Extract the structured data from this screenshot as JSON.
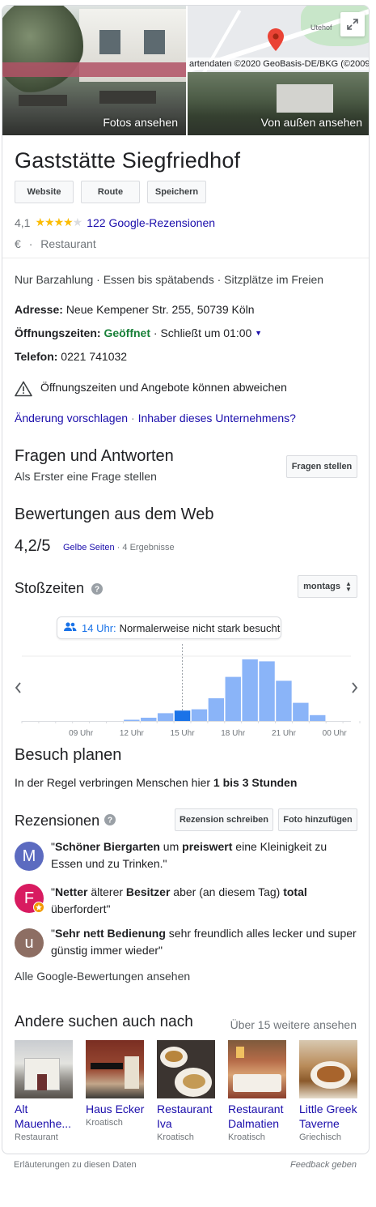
{
  "hero": {
    "photos_label": "Fotos ansehen",
    "outside_label": "Von außen ansehen",
    "map_credit": "artendaten ©2020 GeoBasis-DE/BKG (©2009)",
    "map_street": "Utehof"
  },
  "place": {
    "name": "Gaststätte Siegfriedhof",
    "buttons": [
      "Website",
      "Route",
      "Speichern"
    ],
    "rating": "4,1",
    "stars": 4,
    "reviews_link": "122 Google-Rezensionen",
    "price": "€",
    "separator": "·",
    "category": "Restaurant"
  },
  "details": {
    "attributes": "Nur Barzahlung · Essen bis spätabends · Sitzplätze im Freien",
    "address_label": "Adresse:",
    "address": "Neue Kempener Str. 255, 50739 Köln",
    "hours_label": "Öffnungszeiten:",
    "hours_status": "Geöffnet",
    "hours_close": "· Schließt um 01:00",
    "phone_label": "Telefon:",
    "phone": "0221 741032",
    "warning": "Öffnungszeiten und Angebote können abweichen",
    "suggest_edit": "Änderung vorschlagen",
    "dot": " · ",
    "owner": "Inhaber dieses Unternehmens?"
  },
  "qa": {
    "title": "Fragen und Antworten",
    "first_question": "Als Erster eine Frage stellen",
    "ask_button": "Fragen stellen"
  },
  "web_ratings": {
    "title": "Bewertungen aus dem Web",
    "score": "4,2/5",
    "source": "Gelbe Seiten",
    "results": "· 4 Ergebnisse"
  },
  "popular_times": {
    "title": "Stoßzeiten",
    "day": "montags",
    "tooltip_time": "14 Uhr:",
    "tooltip_text": "Normalerweise nicht stark besucht",
    "current_hour_index": 9
  },
  "chart_data": {
    "type": "bar",
    "categories": [
      "06",
      "07",
      "08",
      "09",
      "10",
      "11",
      "12",
      "13",
      "14",
      "15",
      "16",
      "17",
      "18",
      "19",
      "20",
      "21",
      "22",
      "23",
      "00",
      "01"
    ],
    "values": [
      0,
      0,
      0,
      0,
      0,
      0,
      1,
      5,
      12,
      16,
      18,
      35,
      68,
      95,
      92,
      62,
      28,
      9,
      0,
      0
    ],
    "tick_labels": [
      "09 Uhr",
      "12 Uhr",
      "15 Uhr",
      "18 Uhr",
      "21 Uhr",
      "00 Uhr"
    ],
    "tick_indices": [
      3,
      6,
      9,
      12,
      15,
      18
    ],
    "ylim": [
      0,
      100
    ],
    "colors": {
      "bar": "#8ab4f8",
      "current": "#1a73e8",
      "tooltip_icon": "#1a73e8"
    }
  },
  "visit": {
    "title": "Besuch planen",
    "text_prefix": "In der Regel verbringen Menschen hier ",
    "duration": "1 bis 3 Stunden"
  },
  "reviews": {
    "title": "Rezensionen",
    "write_button": "Rezension schreiben",
    "photo_button": "Foto hinzufügen",
    "items": [
      {
        "initial": "M",
        "color": "#5c6bc0",
        "parts": [
          "\"",
          "Schöner Biergarten",
          " um ",
          "preiswert",
          " eine Kleinigkeit zu Essen und zu Trinken.\""
        ]
      },
      {
        "initial": "F",
        "color": "#d81b60",
        "parts": [
          "\"",
          "Netter",
          " älterer ",
          "Besitzer",
          " aber (an diesem Tag) ",
          "total",
          " überfordert\""
        ]
      },
      {
        "initial": "u",
        "color": "#8d6e63",
        "parts": [
          "\"",
          "Sehr nett Bedienung",
          " sehr freundlich alles lecker und super günstig immer wieder\""
        ]
      }
    ],
    "all_link": "Alle Google-Bewertungen ansehen"
  },
  "also_searched": {
    "title": "Andere suchen auch nach",
    "more": "Über 15 weitere ansehen",
    "items": [
      {
        "name": "Alt Mauenhe...",
        "type": "Restaurant"
      },
      {
        "name": "Haus Ecker",
        "type": "Kroatisch"
      },
      {
        "name": "Restaurant Iva",
        "type": "Kroatisch"
      },
      {
        "name": "Restaurant Dalmatien",
        "type": "Kroatisch"
      },
      {
        "name": "Little Greek Taverne",
        "type": "Griechisch"
      }
    ]
  },
  "footer": {
    "explanations": "Erläuterungen zu diesen Daten",
    "feedback": "Feedback geben"
  }
}
